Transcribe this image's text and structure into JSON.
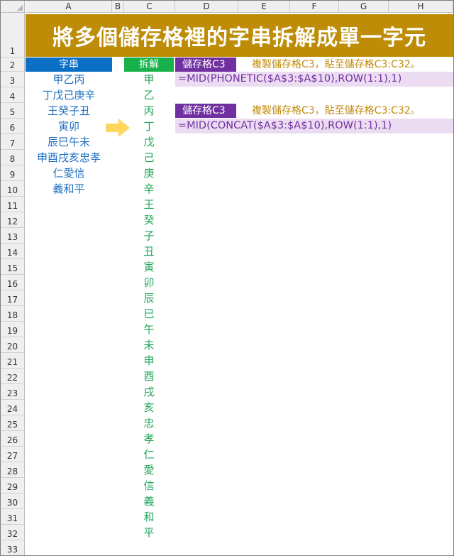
{
  "columns": [
    "A",
    "B",
    "C",
    "D",
    "E",
    "F",
    "G",
    "H"
  ],
  "rows": [
    "1",
    "2",
    "3",
    "4",
    "5",
    "6",
    "7",
    "8",
    "9",
    "10",
    "11",
    "12",
    "13",
    "14",
    "15",
    "16",
    "17",
    "18",
    "19",
    "20",
    "21",
    "22",
    "23",
    "24",
    "25",
    "26",
    "27",
    "28",
    "29",
    "30",
    "31",
    "32",
    "33"
  ],
  "banner_title": "將多個儲存格裡的字串拆解成單一字元",
  "header_a": "字串",
  "header_c": "拆解",
  "cell_label_1": "儲存格C3",
  "note_1": "複製儲存格C3，貼至儲存格C3:C32。",
  "formula_1": "=MID(PHONETIC($A$3:$A$10),ROW(1:1),1)",
  "cell_label_2": "儲存格C3",
  "note_2": "複製儲存格C3，貼至儲存格C3:C32。",
  "formula_2": "=MID(CONCAT($A$3:$A$10),ROW(1:1),1)",
  "strings": [
    "甲乙丙",
    "丁戊己庚辛",
    "王癸子丑",
    "寅卯",
    "辰巳午未",
    "申酉戌亥忠孝",
    "仁愛信",
    "義和平"
  ],
  "chars": [
    "甲",
    "乙",
    "丙",
    "丁",
    "戊",
    "己",
    "庚",
    "辛",
    "王",
    "癸",
    "子",
    "丑",
    "寅",
    "卯",
    "辰",
    "巳",
    "午",
    "未",
    "申",
    "酉",
    "戌",
    "亥",
    "忠",
    "孝",
    "仁",
    "愛",
    "信",
    "義",
    "和",
    "平"
  ],
  "colors": {
    "banner": "#be8c06",
    "header_a": "#0b6fc6",
    "header_c": "#17b24b",
    "cell_label": "#7030a0",
    "formula_bg": "#ecdcf2",
    "note": "#c08a0a",
    "arrow": "#ffd65c"
  },
  "icons": {
    "arrow": "right-arrow-icon"
  }
}
